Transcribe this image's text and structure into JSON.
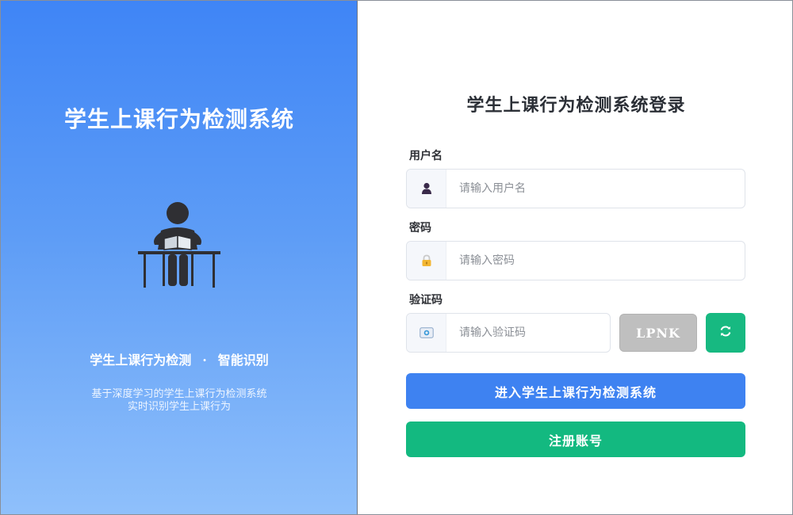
{
  "left": {
    "title": "学生上课行为检测系统",
    "tagline_left": "学生上课行为检测",
    "tagline_sep": "·",
    "tagline_right": "智能识别",
    "desc_line1": "基于深度学习的学生上课行为检测系统",
    "desc_line2": "实时识别学生上课行为",
    "illustration_icon": "student-reading-at-desk-icon"
  },
  "form": {
    "title": "学生上课行为检测系统登录",
    "username": {
      "label": "用户名",
      "placeholder": "请输入用户名",
      "value": "",
      "icon": "user-icon"
    },
    "password": {
      "label": "密码",
      "placeholder": "请输入密码",
      "value": "",
      "icon": "lock-icon"
    },
    "captcha": {
      "label": "验证码",
      "placeholder": "请输入验证码",
      "value": "",
      "icon": "id-card-icon",
      "code": "LPNK",
      "refresh_icon": "refresh-icon"
    },
    "login_button": "进入学生上课行为检测系统",
    "register_button": "注册账号"
  },
  "colors": {
    "gradient_top": "#3f85f6",
    "gradient_bottom": "#8fc0fb",
    "primary_blue": "#3e82f1",
    "primary_green": "#13b980",
    "captcha_gray": "#bfbfbf"
  }
}
